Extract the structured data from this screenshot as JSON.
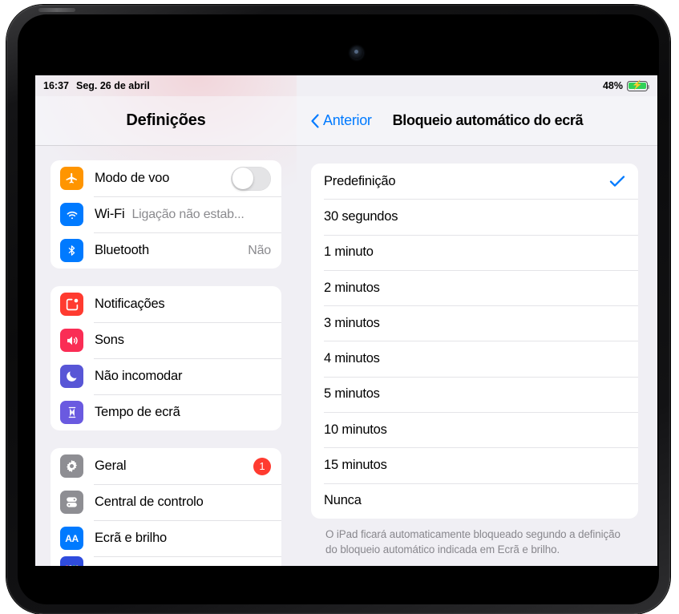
{
  "status_bar": {
    "time": "16:37",
    "date": "Seg. 26 de abril",
    "battery_percent": "48%",
    "battery_state": "charging"
  },
  "sidebar": {
    "title": "Definições",
    "groups": [
      {
        "items": [
          {
            "label": "Modo de voo",
            "icon": "airplane-icon",
            "color": "#ff9500",
            "control": "switch",
            "switch_on": false
          },
          {
            "label": "Wi-Fi",
            "icon": "wifi-icon",
            "color": "#007aff",
            "value": "Ligação não estab...",
            "value_inline": true
          },
          {
            "label": "Bluetooth",
            "icon": "bluetooth-icon",
            "color": "#007aff",
            "value": "Não"
          }
        ]
      },
      {
        "items": [
          {
            "label": "Notificações",
            "icon": "notifications-icon",
            "color": "#ff3b30"
          },
          {
            "label": "Sons",
            "icon": "sound-icon",
            "color": "#fa2d55"
          },
          {
            "label": "Não incomodar",
            "icon": "moon-icon",
            "color": "#5856d6"
          },
          {
            "label": "Tempo de ecrã",
            "icon": "hourglass-icon",
            "color": "#6a5ae0"
          }
        ]
      },
      {
        "items": [
          {
            "label": "Geral",
            "icon": "gear-icon",
            "color": "#8e8e93",
            "badge": "1"
          },
          {
            "label": "Central de controlo",
            "icon": "control-center-icon",
            "color": "#8e8e93"
          },
          {
            "label": "Ecrã e brilho",
            "icon": "display-brightness-icon",
            "color": "#007aff",
            "glyph": "AA"
          },
          {
            "label": "",
            "icon": "home-screen-dock-icon",
            "color": "#2f4cdd",
            "cutoff": true
          }
        ]
      }
    ]
  },
  "detail": {
    "back_label": "Anterior",
    "title": "Bloqueio automático do ecrã",
    "selected_option": "Predefinição",
    "accent_color": "#007aff",
    "options": [
      {
        "label": "Predefinição",
        "selected": true
      },
      {
        "label": "30 segundos",
        "selected": false
      },
      {
        "label": "1 minuto",
        "selected": false
      },
      {
        "label": "2 minutos",
        "selected": false
      },
      {
        "label": "3 minutos",
        "selected": false
      },
      {
        "label": "4 minutos",
        "selected": false
      },
      {
        "label": "5 minutos",
        "selected": false
      },
      {
        "label": "10 minutos",
        "selected": false
      },
      {
        "label": "15 minutos",
        "selected": false
      },
      {
        "label": "Nunca",
        "selected": false
      }
    ],
    "footer_note": "O iPad ficará automaticamente bloqueado segundo a definição do bloqueio automático indicada em Ecrã e brilho."
  }
}
